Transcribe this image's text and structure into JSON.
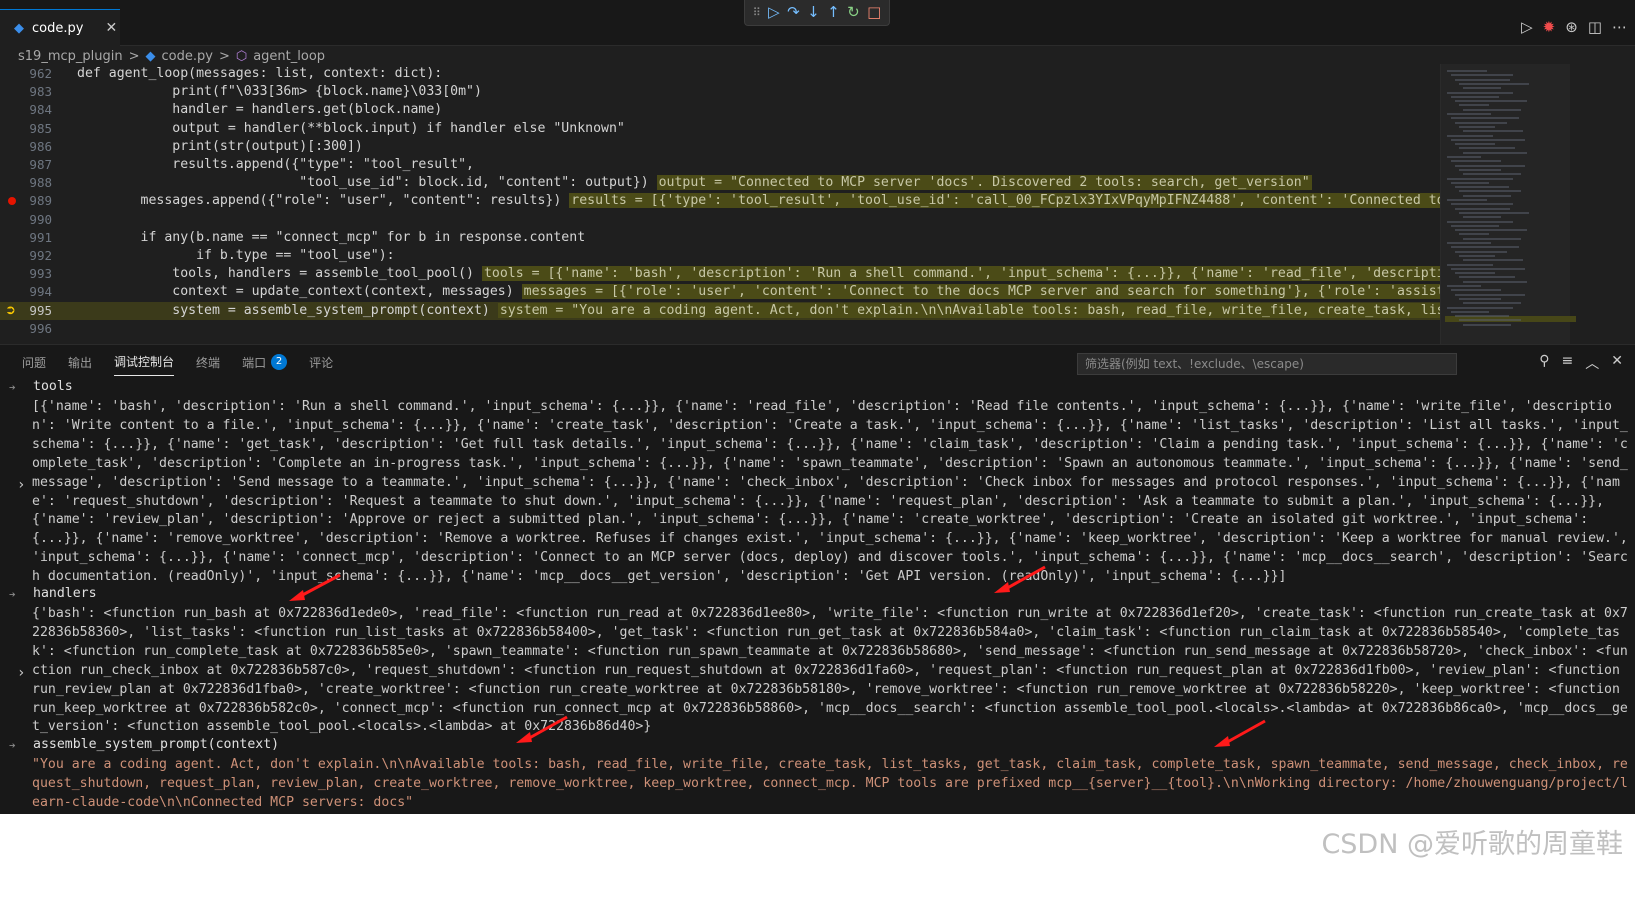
{
  "tab": {
    "filename": "code.py",
    "close": "✕"
  },
  "breadcrumb": {
    "folder": "s19_mcp_plugin",
    "sep1": ">",
    "file": "code.py",
    "sep2": ">",
    "symbol": "agent_loop"
  },
  "editor_lines": [
    {
      "num": "962",
      "text": "def agent_loop(messages: list, context: dict):"
    },
    {
      "num": "983",
      "text": "            print(f\"\\033[36m> {block.name}\\033[0m\")"
    },
    {
      "num": "984",
      "text": "            handler = handlers.get(block.name)"
    },
    {
      "num": "985",
      "text": "            output = handler(**block.input) if handler else \"Unknown\""
    },
    {
      "num": "986",
      "text": "            print(str(output)[:300])"
    },
    {
      "num": "987",
      "text": "            results.append({\"type\": \"tool_result\","
    },
    {
      "num": "988",
      "text": "                            \"tool_use_id\": block.id, \"content\": output})",
      "inline": "output = \"Connected to MCP server 'docs'. Discovered 2 tools: search, get_version\""
    },
    {
      "num": "989",
      "text": "        messages.append({\"role\": \"user\", \"content\": results})",
      "inline": "results = [{'type': 'tool_result', 'tool_use_id': 'call_00_FCpzlx3YIxVPqyMpIFNZ4488', 'content': 'Connected to MCP server "
    },
    {
      "num": "990",
      "text": ""
    },
    {
      "num": "991",
      "text": "        if any(b.name == \"connect_mcp\" for b in response.content"
    },
    {
      "num": "992",
      "text": "               if b.type == \"tool_use\"):"
    },
    {
      "num": "993",
      "text": "            tools, handlers = assemble_tool_pool()",
      "inline": "tools = [{'name': 'bash', 'description': 'Run a shell command.', 'input_schema': {...}}, {'name': 'read_file', 'description': 'Read fi"
    },
    {
      "num": "994",
      "text": "            context = update_context(context, messages)",
      "inline": "messages = [{'role': 'user', 'content': 'Connect to the docs MCP server and search for something'}, {'role': 'assistant', 'conter"
    },
    {
      "num": "995",
      "text": "            system = assemble_system_prompt(context)",
      "inline": "system = \"You are a coding agent. Act, don't explain.\\n\\nAvailable tools: bash, read_file, write_file, create_task, list_tasks, get"
    },
    {
      "num": "996",
      "text": ""
    }
  ],
  "panel": {
    "tabs": [
      "问题",
      "输出",
      "调试控制台",
      "终端",
      "端口",
      "评论"
    ],
    "ports_badge": "2",
    "filter_placeholder": "筛选器(例如 text、!exclude、\\escape)"
  },
  "console": [
    {
      "expr": "tools",
      "result": "[{'name': 'bash', 'description': 'Run a shell command.', 'input_schema': {...}}, {'name': 'read_file', 'description': 'Read file contents.', 'input_schema': {...}}, {'name': 'write_file', 'description': 'Write content to a file.', 'input_schema': {...}}, {'name': 'create_task', 'description': 'Create a task.', 'input_schema': {...}}, {'name': 'list_tasks', 'description': 'List all tasks.', 'input_schema': {...}}, {'name': 'get_task', 'description': 'Get full task details.', 'input_schema': {...}}, {'name': 'claim_task', 'description': 'Claim a pending task.', 'input_schema': {...}}, {'name': 'complete_task', 'description': 'Complete an in-progress task.', 'input_schema': {...}}, {'name': 'spawn_teammate', 'description': 'Spawn an autonomous teammate.', 'input_schema': {...}}, {'name': 'send_message', 'description': 'Send message to a teammate.', 'input_schema': {...}}, {'name': 'check_inbox', 'description': 'Check inbox for messages and protocol responses.', 'input_schema': {...}}, {'name': 'request_shutdown', 'description': 'Request a teammate to shut down.', 'input_schema': {...}}, {'name': 'request_plan', 'description': 'Ask a teammate to submit a plan.', 'input_schema': {...}}, {'name': 'review_plan', 'description': 'Approve or reject a submitted plan.', 'input_schema': {...}}, {'name': 'create_worktree', 'description': 'Create an isolated git worktree.', 'input_schema': {...}}, {'name': 'remove_worktree', 'description': 'Remove a worktree. Refuses if changes exist.', 'input_schema': {...}}, {'name': 'keep_worktree', 'description': 'Keep a worktree for manual review.', 'input_schema': {...}}, {'name': 'connect_mcp', 'description': 'Connect to an MCP server (docs, deploy) and discover tools.', 'input_schema': {...}}, {'name': 'mcp__docs__search', 'description': 'Search documentation. (readOnly)', 'input_schema': {...}}, {'name': 'mcp__docs__get_version', 'description': 'Get API version. (readOnly)', 'input_schema': {...}}]"
    },
    {
      "expr": "handlers",
      "result": "{'bash': <function run_bash at 0x722836d1ede0>, 'read_file': <function run_read at 0x722836d1ee80>, 'write_file': <function run_write at 0x722836d1ef20>, 'create_task': <function run_create_task at 0x722836b58360>, 'list_tasks': <function run_list_tasks at 0x722836b58400>, 'get_task': <function run_get_task at 0x722836b584a0>, 'claim_task': <function run_claim_task at 0x722836b58540>, 'complete_task': <function run_complete_task at 0x722836b585e0>, 'spawn_teammate': <function run_spawn_teammate at 0x722836b58680>, 'send_message': <function run_send_message at 0x722836b58720>, 'check_inbox': <function run_check_inbox at 0x722836b587c0>, 'request_shutdown': <function run_request_shutdown at 0x722836d1fa60>, 'request_plan': <function run_request_plan at 0x722836d1fb00>, 'review_plan': <function run_review_plan at 0x722836d1fba0>, 'create_worktree': <function run_create_worktree at 0x722836b58180>, 'remove_worktree': <function run_remove_worktree at 0x722836b58220>, 'keep_worktree': <function run_keep_worktree at 0x722836b582c0>, 'connect_mcp': <function run_connect_mcp at 0x722836b58860>, 'mcp__docs__search': <function assemble_tool_pool.<locals>.<lambda> at 0x722836b86ca0>, 'mcp__docs__get_version': <function assemble_tool_pool.<locals>.<lambda> at 0x722836b86d40>}"
    },
    {
      "expr": "assemble_system_prompt(context)",
      "result": "\"You are a coding agent. Act, don't explain.\\n\\nAvailable tools: bash, read_file, write_file, create_task, list_tasks, get_task, claim_task, complete_task, spawn_teammate, send_message, check_inbox, request_shutdown, request_plan, review_plan, create_worktree, remove_worktree, keep_worktree, connect_mcp. MCP tools are prefixed mcp__{server}__{tool}.\\n\\nWorking directory: /home/zhouwenguang/project/learn-claude-code\\n\\nConnected MCP servers: docs\""
    }
  ],
  "watermark": "CSDN @爱听歌的周童鞋",
  "colors": {
    "accent": "#0078d4",
    "breakpoint": "#e51400",
    "current_line": "#3b3a1a",
    "inline_value_bg": "#4b4b17",
    "annotation_arrow": "#ff1a1a"
  }
}
